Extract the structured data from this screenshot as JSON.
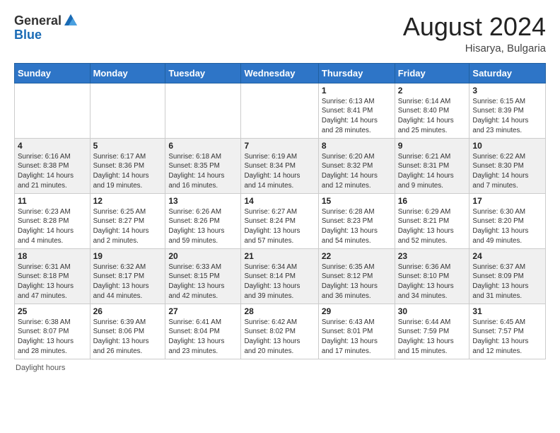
{
  "header": {
    "logo_general": "General",
    "logo_blue": "Blue",
    "month_title": "August 2024",
    "location": "Hisarya, Bulgaria"
  },
  "calendar": {
    "days_of_week": [
      "Sunday",
      "Monday",
      "Tuesday",
      "Wednesday",
      "Thursday",
      "Friday",
      "Saturday"
    ],
    "weeks": [
      [
        {
          "day": "",
          "info": ""
        },
        {
          "day": "",
          "info": ""
        },
        {
          "day": "",
          "info": ""
        },
        {
          "day": "",
          "info": ""
        },
        {
          "day": "1",
          "info": "Sunrise: 6:13 AM\nSunset: 8:41 PM\nDaylight: 14 hours\nand 28 minutes."
        },
        {
          "day": "2",
          "info": "Sunrise: 6:14 AM\nSunset: 8:40 PM\nDaylight: 14 hours\nand 25 minutes."
        },
        {
          "day": "3",
          "info": "Sunrise: 6:15 AM\nSunset: 8:39 PM\nDaylight: 14 hours\nand 23 minutes."
        }
      ],
      [
        {
          "day": "4",
          "info": "Sunrise: 6:16 AM\nSunset: 8:38 PM\nDaylight: 14 hours\nand 21 minutes."
        },
        {
          "day": "5",
          "info": "Sunrise: 6:17 AM\nSunset: 8:36 PM\nDaylight: 14 hours\nand 19 minutes."
        },
        {
          "day": "6",
          "info": "Sunrise: 6:18 AM\nSunset: 8:35 PM\nDaylight: 14 hours\nand 16 minutes."
        },
        {
          "day": "7",
          "info": "Sunrise: 6:19 AM\nSunset: 8:34 PM\nDaylight: 14 hours\nand 14 minutes."
        },
        {
          "day": "8",
          "info": "Sunrise: 6:20 AM\nSunset: 8:32 PM\nDaylight: 14 hours\nand 12 minutes."
        },
        {
          "day": "9",
          "info": "Sunrise: 6:21 AM\nSunset: 8:31 PM\nDaylight: 14 hours\nand 9 minutes."
        },
        {
          "day": "10",
          "info": "Sunrise: 6:22 AM\nSunset: 8:30 PM\nDaylight: 14 hours\nand 7 minutes."
        }
      ],
      [
        {
          "day": "11",
          "info": "Sunrise: 6:23 AM\nSunset: 8:28 PM\nDaylight: 14 hours\nand 4 minutes."
        },
        {
          "day": "12",
          "info": "Sunrise: 6:25 AM\nSunset: 8:27 PM\nDaylight: 14 hours\nand 2 minutes."
        },
        {
          "day": "13",
          "info": "Sunrise: 6:26 AM\nSunset: 8:26 PM\nDaylight: 13 hours\nand 59 minutes."
        },
        {
          "day": "14",
          "info": "Sunrise: 6:27 AM\nSunset: 8:24 PM\nDaylight: 13 hours\nand 57 minutes."
        },
        {
          "day": "15",
          "info": "Sunrise: 6:28 AM\nSunset: 8:23 PM\nDaylight: 13 hours\nand 54 minutes."
        },
        {
          "day": "16",
          "info": "Sunrise: 6:29 AM\nSunset: 8:21 PM\nDaylight: 13 hours\nand 52 minutes."
        },
        {
          "day": "17",
          "info": "Sunrise: 6:30 AM\nSunset: 8:20 PM\nDaylight: 13 hours\nand 49 minutes."
        }
      ],
      [
        {
          "day": "18",
          "info": "Sunrise: 6:31 AM\nSunset: 8:18 PM\nDaylight: 13 hours\nand 47 minutes."
        },
        {
          "day": "19",
          "info": "Sunrise: 6:32 AM\nSunset: 8:17 PM\nDaylight: 13 hours\nand 44 minutes."
        },
        {
          "day": "20",
          "info": "Sunrise: 6:33 AM\nSunset: 8:15 PM\nDaylight: 13 hours\nand 42 minutes."
        },
        {
          "day": "21",
          "info": "Sunrise: 6:34 AM\nSunset: 8:14 PM\nDaylight: 13 hours\nand 39 minutes."
        },
        {
          "day": "22",
          "info": "Sunrise: 6:35 AM\nSunset: 8:12 PM\nDaylight: 13 hours\nand 36 minutes."
        },
        {
          "day": "23",
          "info": "Sunrise: 6:36 AM\nSunset: 8:10 PM\nDaylight: 13 hours\nand 34 minutes."
        },
        {
          "day": "24",
          "info": "Sunrise: 6:37 AM\nSunset: 8:09 PM\nDaylight: 13 hours\nand 31 minutes."
        }
      ],
      [
        {
          "day": "25",
          "info": "Sunrise: 6:38 AM\nSunset: 8:07 PM\nDaylight: 13 hours\nand 28 minutes."
        },
        {
          "day": "26",
          "info": "Sunrise: 6:39 AM\nSunset: 8:06 PM\nDaylight: 13 hours\nand 26 minutes."
        },
        {
          "day": "27",
          "info": "Sunrise: 6:41 AM\nSunset: 8:04 PM\nDaylight: 13 hours\nand 23 minutes."
        },
        {
          "day": "28",
          "info": "Sunrise: 6:42 AM\nSunset: 8:02 PM\nDaylight: 13 hours\nand 20 minutes."
        },
        {
          "day": "29",
          "info": "Sunrise: 6:43 AM\nSunset: 8:01 PM\nDaylight: 13 hours\nand 17 minutes."
        },
        {
          "day": "30",
          "info": "Sunrise: 6:44 AM\nSunset: 7:59 PM\nDaylight: 13 hours\nand 15 minutes."
        },
        {
          "day": "31",
          "info": "Sunrise: 6:45 AM\nSunset: 7:57 PM\nDaylight: 13 hours\nand 12 minutes."
        }
      ]
    ]
  },
  "footer": {
    "text": "Daylight hours"
  }
}
